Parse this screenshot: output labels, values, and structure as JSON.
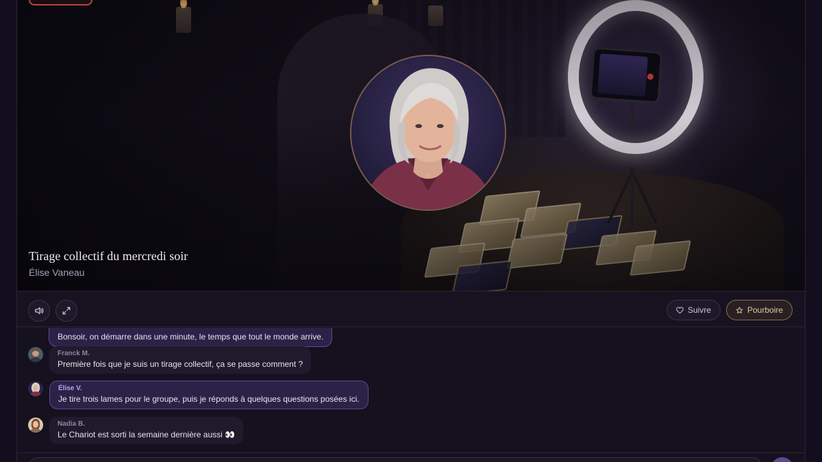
{
  "stream": {
    "title": "Tirage collectif du mercredi soir",
    "host": "Élise Vaneau"
  },
  "controls": {
    "follow_label": "Suivre",
    "tip_label": "Pourboire"
  },
  "chat": {
    "messages": [
      {
        "author": "",
        "text": "Bonsoir, on démarre dans une minute, le temps que tout le monde arrive.",
        "is_host": true
      },
      {
        "author": "Franck M.",
        "text": "Première fois que je suis un tirage collectif, ça se passe comment ?",
        "is_host": false
      },
      {
        "author": "Élise V.",
        "text": "Je tire trois lames pour le groupe, puis je réponds à quelques questions posées ici.",
        "is_host": true
      },
      {
        "author": "Nadia B.",
        "text": "Le Chariot est sorti la semaine dernière aussi 👀",
        "is_host": false
      }
    ]
  },
  "colors": {
    "background": "#120e1d",
    "accent": "#5b4a91",
    "tip_accent": "#e6c899"
  }
}
